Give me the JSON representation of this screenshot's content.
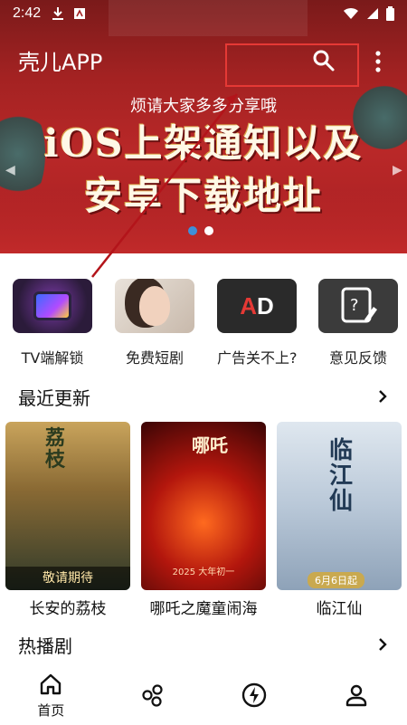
{
  "status_bar": {
    "time": "2:42"
  },
  "toolbar": {
    "title": "壳儿APP"
  },
  "banner": {
    "subtitle": "烦请大家多多分享哦",
    "line1": "iOS上架通知以及",
    "line2": "安卓下载地址",
    "dot_count": 2,
    "active_dot": 1
  },
  "quick_actions": [
    {
      "label": "TV端解锁",
      "icon": "tv-icon"
    },
    {
      "label": "免费短剧",
      "icon": "drama-thumbnail"
    },
    {
      "label": "广告关不上?",
      "icon": "ad-icon"
    },
    {
      "label": "意见反馈",
      "icon": "feedback-icon"
    }
  ],
  "recent": {
    "title": "最近更新",
    "items": [
      {
        "name": "长安的荔枝",
        "poster_caption": "敬请期待"
      },
      {
        "name": "哪吒之魔童闹海",
        "poster_caption": "2025 大年初一"
      },
      {
        "name": "临江仙",
        "poster_caption": "6月6日起"
      }
    ]
  },
  "hot": {
    "title": "热播剧"
  },
  "bottom_nav": {
    "items": [
      {
        "label": "首页",
        "icon": "home-icon"
      },
      {
        "label": "",
        "icon": "discover-icon"
      },
      {
        "label": "",
        "icon": "lightning-icon"
      },
      {
        "label": "",
        "icon": "profile-icon"
      }
    ]
  },
  "colors": {
    "banner_red": "#b92828",
    "highlight_red": "#e53935",
    "dot_blue": "#3f8fd9"
  }
}
